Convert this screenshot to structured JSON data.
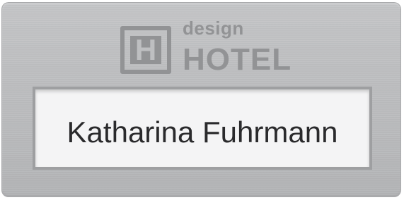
{
  "badge": {
    "logo": {
      "letter": "H",
      "word_small": "design",
      "word_large": "HOTEL"
    },
    "name": "Katharina Fuhrmann"
  },
  "colors": {
    "badge_metal": "#bdbec0",
    "logo_gray": "#929395",
    "window_paper": "#f4f4f5",
    "name_text": "#2a2a2c"
  }
}
